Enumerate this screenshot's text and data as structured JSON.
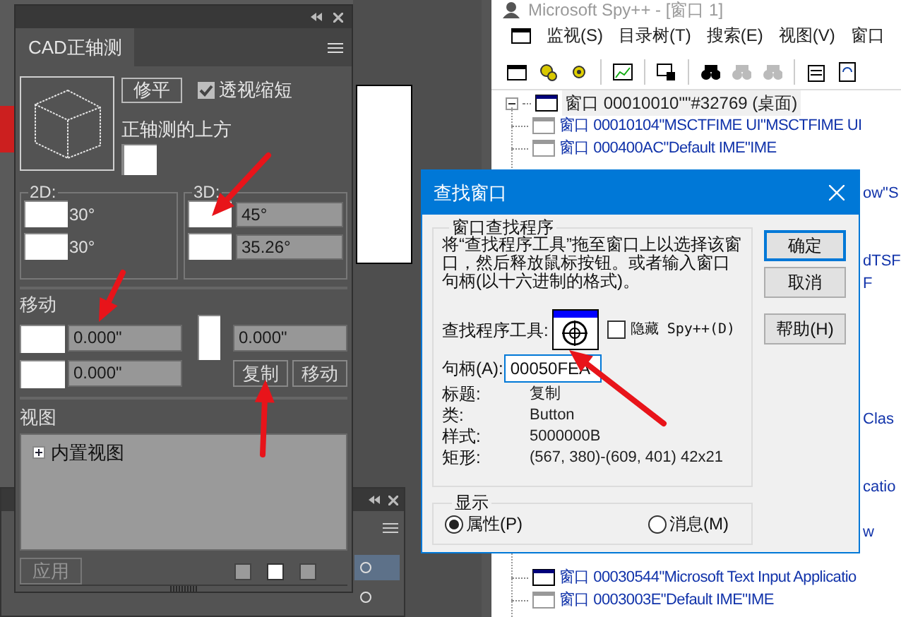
{
  "cad_panel": {
    "tab": "CAD正轴测",
    "flatten_button": "修平",
    "foreshorten": {
      "label": "透视缩短",
      "checked": true
    },
    "preset_label": "正轴测的上方",
    "group_2d": {
      "title": "2D:",
      "angles": [
        "30°",
        "30°"
      ]
    },
    "group_3d": {
      "title": "3D:",
      "angles": [
        "45°",
        "35.26°"
      ]
    },
    "move": {
      "title": "移动",
      "values": [
        "0.000\"",
        "0.000\"",
        "0.000\""
      ],
      "buttons": [
        "复制",
        "移动"
      ]
    },
    "views": {
      "title": "视图",
      "items": [
        {
          "label": "内置视图",
          "expanded": false
        }
      ]
    },
    "apply_button": {
      "label": "应用",
      "disabled": true
    },
    "view_modes": [
      {
        "selected": false
      },
      {
        "selected": true
      },
      {
        "selected": false
      }
    ]
  },
  "spy_window": {
    "title": "Microsoft Spy++ - [窗口 1]",
    "menu": [
      "监视(S)",
      "目录树(T)",
      "搜索(E)",
      "视图(V)",
      "窗口"
    ],
    "tree": {
      "label": "窗口 00010010\"\"#32769 (桌面)",
      "expanded": true,
      "selected": true,
      "children": [
        {
          "kind": "row",
          "label": "窗口 00010104\"MSCTFIME UI\"MSCTFIME UI",
          "visible": false
        },
        {
          "kind": "row",
          "label": "窗口 000400AC\"Default IME\"IME",
          "visible": false
        },
        {
          "kind": "fragment",
          "label": "ow\"S"
        },
        {
          "kind": "fragment",
          "label": "dTSF"
        },
        {
          "kind": "fragment",
          "label": "F"
        },
        {
          "kind": "fragment",
          "label": "Clas"
        },
        {
          "kind": "fragment",
          "label": "catio"
        },
        {
          "kind": "fragment",
          "label": "w"
        },
        {
          "kind": "row",
          "label": "窗口 00030544\"Microsoft Text Input Applicatio",
          "visible": true
        },
        {
          "kind": "row",
          "label": "窗口 0003003E\"Default IME\"IME",
          "visible": false
        }
      ]
    }
  },
  "find_dialog": {
    "title": "查找窗口",
    "group_title": "窗口查找程序",
    "instructions": "将“查找程序工具”拖至窗口上以选择该窗口，然后释放鼠标按钮。或者输入窗口句柄(以十六进制的格式)。",
    "finder_label": "查找程序工具:",
    "hide_spy": {
      "label": "隐藏 Spy++(D)",
      "checked": false
    },
    "handle": {
      "label": "句柄(A):",
      "value": "00050FEA"
    },
    "info": [
      {
        "label": "标题:",
        "value": "复制"
      },
      {
        "label": "类:",
        "value": "Button"
      },
      {
        "label": "样式:",
        "value": "5000000B"
      },
      {
        "label": "矩形:",
        "value": "(567, 380)-(609, 401) 42x21"
      }
    ],
    "display": {
      "title": "显示",
      "options": [
        {
          "label": "属性(P)",
          "selected": true
        },
        {
          "label": "消息(M)",
          "selected": false
        }
      ]
    },
    "buttons": [
      {
        "label": "确定",
        "default": true
      },
      {
        "label": "取消",
        "default": false
      },
      {
        "label": "帮助(H)",
        "default": false
      }
    ]
  }
}
